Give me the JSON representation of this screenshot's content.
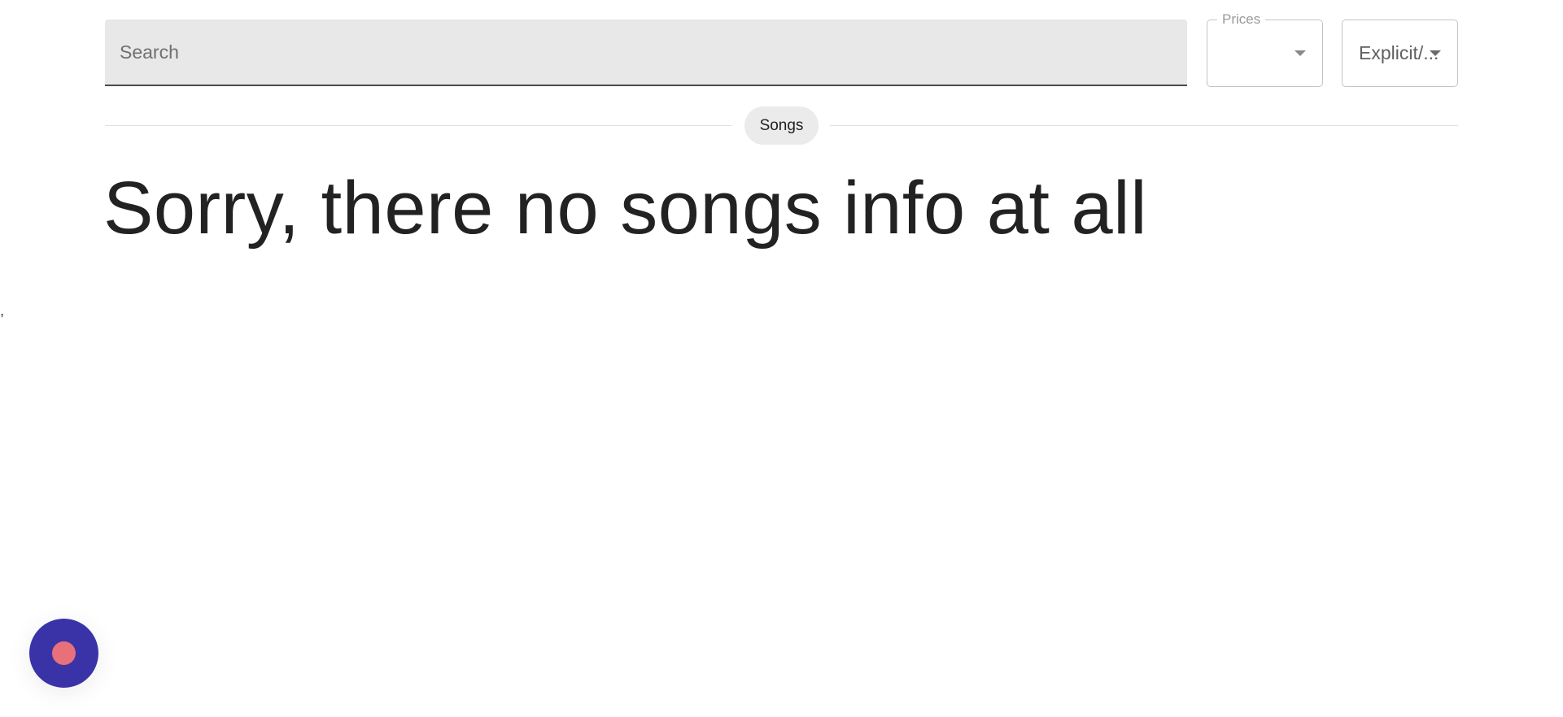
{
  "search": {
    "placeholder": "Search",
    "value": ""
  },
  "filters": {
    "prices": {
      "label": "Prices",
      "value": ""
    },
    "explicit": {
      "value": "Explicit/..."
    }
  },
  "section": {
    "chip_label": "Songs"
  },
  "empty_state": {
    "message": "Sorry, there no songs info at all"
  },
  "stray_text": ",",
  "fab": {
    "icon": "record-dot-icon"
  },
  "colors": {
    "fab_background": "#3a33a8",
    "fab_dot": "#e8707a",
    "search_background": "#e8e8e8"
  }
}
